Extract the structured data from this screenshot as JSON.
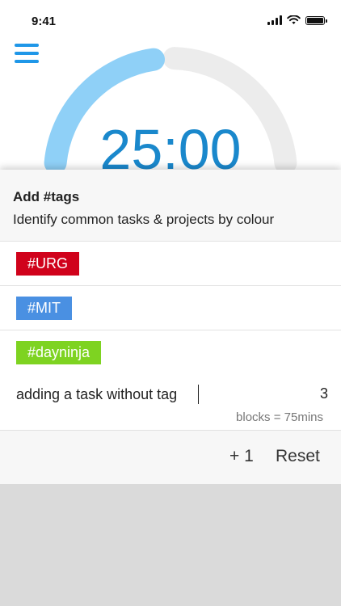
{
  "status_bar": {
    "time": "9:41",
    "icons": [
      "signal-icon",
      "wifi-icon",
      "battery-icon"
    ]
  },
  "menu": {
    "icon": "hamburger-menu-icon"
  },
  "timer": {
    "display": "25:00",
    "progress_fraction": 0.45,
    "accent": "#8fd0f7",
    "track": "#ececec",
    "text_color": "#1a88cc"
  },
  "tags_panel": {
    "title": "Add #tags",
    "subtitle": "Identify common tasks & projects by colour",
    "tags": [
      {
        "label": "#URG",
        "color": "#d0021b"
      },
      {
        "label": "#MIT",
        "color": "#4a90e2"
      },
      {
        "label": "#dayninja",
        "color": "#7ed321"
      }
    ]
  },
  "task": {
    "value": "adding a task without tag",
    "count": "3",
    "blocks_text": "blocks = 75mins"
  },
  "actions": {
    "plus_label": "+ 1",
    "reset_label": "Reset"
  }
}
